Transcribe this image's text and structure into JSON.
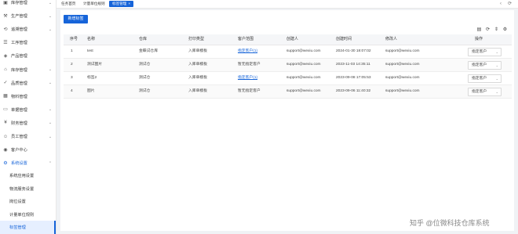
{
  "sidebar": {
    "items": [
      {
        "label": "库存管理",
        "icon": "inventory-icon",
        "open": false
      },
      {
        "label": "生产管理",
        "icon": "production-icon",
        "open": false
      },
      {
        "label": "追溯管理",
        "icon": "trace-icon",
        "open": false
      },
      {
        "label": "工序管理",
        "icon": "process-icon",
        "open": false
      },
      {
        "label": "产品管理",
        "icon": "product-icon",
        "open": false
      },
      {
        "label": "库存管理",
        "icon": "warehouse-icon",
        "open": false
      },
      {
        "label": "品质管理",
        "icon": "quality-icon",
        "open": false
      },
      {
        "label": "物料管理",
        "icon": "material-icon",
        "open": false
      },
      {
        "label": "单据管理",
        "icon": "document-icon",
        "open": false
      },
      {
        "label": "财务管理",
        "icon": "finance-icon",
        "open": false
      },
      {
        "label": "员工管理",
        "icon": "staff-icon",
        "open": false
      },
      {
        "label": "客户中心",
        "icon": "customer-icon",
        "open": false
      },
      {
        "label": "系统设置",
        "icon": "settings-icon",
        "open": true
      }
    ],
    "sub_items": [
      {
        "label": "系统应用设置",
        "active": false
      },
      {
        "label": "物流服务设置",
        "active": false
      },
      {
        "label": "岗位设置",
        "active": false
      },
      {
        "label": "计量单位规则",
        "active": false
      },
      {
        "label": "标签管理",
        "active": true
      }
    ]
  },
  "tabs": [
    {
      "label": "任务首页",
      "active": false
    },
    {
      "label": "计量单位规则",
      "active": false
    },
    {
      "label": "标签管理",
      "active": true,
      "close": "×"
    }
  ],
  "toolbar": {
    "new_button": "新增标签",
    "tools": [
      "print-icon",
      "refresh-icon",
      "column-setting-icon",
      "gear-icon"
    ]
  },
  "table": {
    "columns": [
      "序号",
      "名称",
      "仓库",
      "打印类型",
      "客户范围",
      "创建人",
      "创建时间",
      "修改人",
      "操作"
    ],
    "rows": [
      {
        "no": "1",
        "name": "test",
        "warehouse": "金蝶试仓库",
        "print_type": "入库单模板",
        "scope": "指定客户(1)",
        "scope_link": true,
        "creator": "support@wexiu.com",
        "created": "2024-01-30 18:07:02",
        "modifier": "support@wexiu.com",
        "action": "指定客户"
      },
      {
        "no": "2",
        "name": "测试图片",
        "warehouse": "测试仓",
        "print_type": "入库单模板",
        "scope": "暂无指定客户",
        "scope_link": false,
        "creator": "support@wexiu.com",
        "created": "2023-11-03 14:35:11",
        "modifier": "support@wexiu.com",
        "action": "指定客户"
      },
      {
        "no": "3",
        "name": "标签2",
        "warehouse": "测试仓",
        "print_type": "入库单模板",
        "scope": "指定客户(1)",
        "scope_link": true,
        "creator": "support@wexiu.com",
        "created": "2023-09-08 17:05:53",
        "modifier": "support@wexiu.com",
        "action": "指定客户"
      },
      {
        "no": "4",
        "name": "图片",
        "warehouse": "测试仓",
        "print_type": "入库单模板",
        "scope": "暂无指定客户",
        "scope_link": false,
        "creator": "support@wexiu.com",
        "created": "2023-09-06 11:40:32",
        "modifier": "support@wexiu.com",
        "action": "指定客户"
      }
    ]
  },
  "watermark": "知乎 @位微科技仓库系统",
  "colors": {
    "accent": "#1664d9",
    "sidebar_active_bg": "#e6efff",
    "page_bg": "#f0f2f5"
  }
}
